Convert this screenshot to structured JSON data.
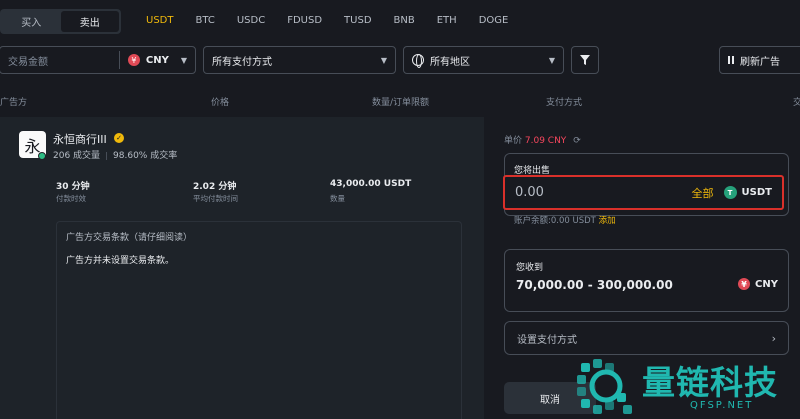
{
  "trade_tabs": {
    "buy": "买入",
    "sell": "卖出"
  },
  "coins": [
    "USDT",
    "BTC",
    "USDC",
    "FDUSD",
    "TUSD",
    "BNB",
    "ETH",
    "DOGE"
  ],
  "filters": {
    "amount_placeholder": "交易金额",
    "currency": "CNY",
    "payment": "所有支付方式",
    "region": "所有地区",
    "refresh": "刷新广告"
  },
  "columns": {
    "advertiser": "广告方",
    "price": "价格",
    "qty_limit": "数量/订单限额",
    "payment": "支付方式",
    "trade_cut": "交"
  },
  "advertiser": {
    "avatar_char": "永",
    "name": "永恒商行III",
    "orders": "206 成交量",
    "rate": "98.60% 成交率"
  },
  "metrics": [
    {
      "value": "30 分钟",
      "label": "付款时效"
    },
    {
      "value": "2.02 分钟",
      "label": "平均付款时间"
    },
    {
      "value": "43,000.00 USDT",
      "label": "数量"
    }
  ],
  "terms": {
    "title": "广告方交易条款（请仔细阅读）",
    "body": "广告方并未设置交易条款。"
  },
  "order": {
    "unit_price_label": "单价",
    "unit_price_value": "7.09 CNY",
    "sell_label": "您将出售",
    "sell_value": "0.00",
    "all_label": "全部",
    "sell_currency": "USDT",
    "balance_label": "账户余额:",
    "balance_value": "0.00 USDT",
    "add_label": "添加",
    "receive_label": "您收到",
    "receive_value": "70,000.00 - 300,000.00",
    "receive_currency": "CNY",
    "payment_method_label": "设置支付方式",
    "cancel_label": "取消"
  },
  "watermark": {
    "text": "量链科技",
    "domain": "QFSP.NET"
  },
  "colors": {
    "accent": "#f0b90b",
    "danger": "#f6465d",
    "highlight_border": "#d9302a",
    "watermark": "#20b8b0"
  }
}
